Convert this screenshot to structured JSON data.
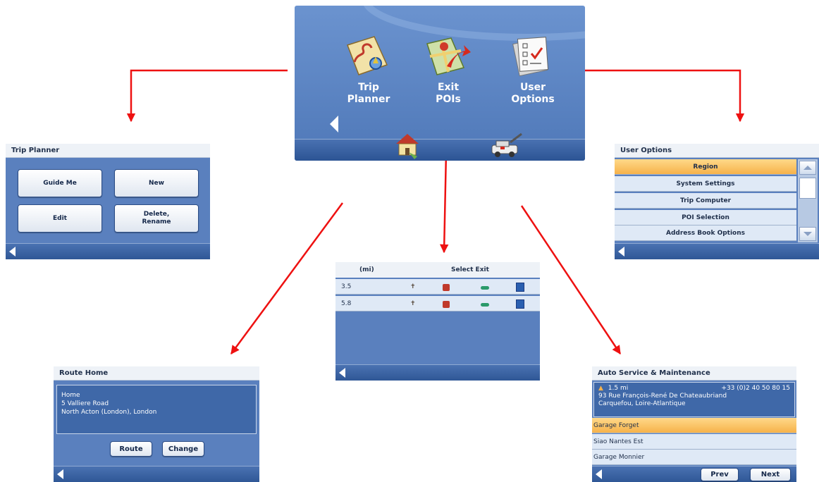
{
  "main_menu": {
    "items": [
      {
        "label_line1": "Trip",
        "label_line2": "Planner",
        "icon": "trip-planner-icon"
      },
      {
        "label_line1": "Exit",
        "label_line2": "POIs",
        "icon": "exit-pois-icon"
      },
      {
        "label_line1": "User",
        "label_line2": "Options",
        "icon": "user-options-icon"
      }
    ],
    "bottom_icons": [
      "route-home-icon",
      "auto-service-icon"
    ]
  },
  "trip_planner": {
    "title": "Trip Planner",
    "buttons": [
      "Guide Me",
      "New",
      "Edit",
      "Delete,\nRename"
    ]
  },
  "user_options": {
    "title": "User Options",
    "items": [
      "Region",
      "System Settings",
      "Trip Computer",
      "POI Selection",
      "Address Book Options"
    ],
    "selected": 0
  },
  "select_exit": {
    "unit_header": "(mi)",
    "title": "Select Exit",
    "rows": [
      {
        "distance": "3.5"
      },
      {
        "distance": "5.8"
      }
    ],
    "service_icons": [
      "restaurant-icon",
      "gas-station-icon",
      "car-icon",
      "lodging-icon"
    ]
  },
  "route_home": {
    "title": "Route Home",
    "address_line1": "Home",
    "address_line2": "5 Valliere Road",
    "address_line3": "North Acton (London), London",
    "route_button": "Route",
    "change_button": "Change"
  },
  "auto_service": {
    "title": "Auto Service & Maintenance",
    "distance": "1.5 mi",
    "phone": "+33 (0)2 40 50 80 15",
    "address_line1": "93 Rue François-René De Chateaubriand",
    "address_line2": "Carquefou, Loire-Atlantique",
    "items": [
      "Garage Forget",
      "Siao Nantes Est",
      "Garage Monnier"
    ],
    "selected": 0,
    "prev_button": "Prev",
    "next_button": "Next"
  },
  "colors": {
    "arrow": "#ee1111",
    "screen_blue": "#5a80be",
    "highlight": "#f6b24a"
  }
}
